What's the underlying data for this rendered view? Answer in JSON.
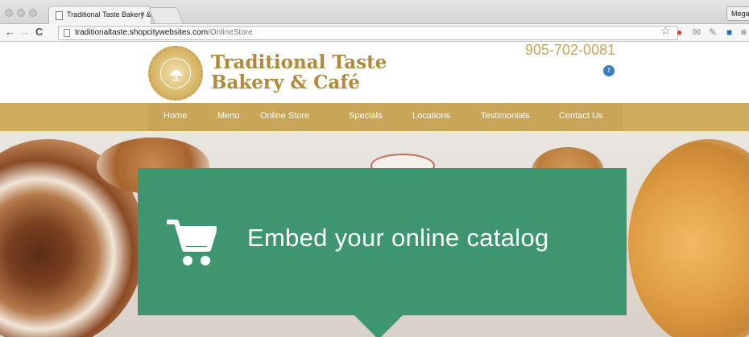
{
  "browser": {
    "tab_title": "Traditional Taste Bakery &",
    "tab_close": "×",
    "profile": "Megan",
    "url_host": "traditionaltaste.shopcitywebsites.com",
    "url_path": "/OnlineStore",
    "icons": [
      "back-icon",
      "forward-icon",
      "reload-icon",
      "page-icon",
      "star-icon"
    ]
  },
  "site": {
    "brand_line1": "Traditional Taste",
    "brand_line2": "Bakery & Café",
    "phone": "905-702-0081",
    "social_badge": "f",
    "nav": [
      "Home",
      "Menu",
      "Online Store",
      "Specials",
      "Locations",
      "Testimonials",
      "Contact Us"
    ],
    "brand_color": "#c9a559"
  },
  "hero": {
    "title": "Embed your online catalog",
    "overlay_color": "#3d9670",
    "icon": "cart-icon"
  }
}
